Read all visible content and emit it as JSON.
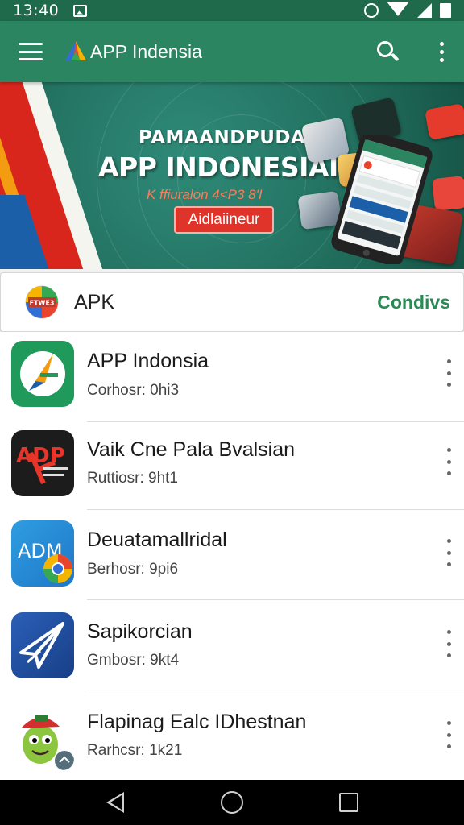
{
  "status_bar": {
    "time": "13:40"
  },
  "toolbar": {
    "title": "APP Indensia"
  },
  "banner": {
    "kicker": "PAMAANDPUDA",
    "headline": "APP INDONESIAI",
    "subline": "K ffiuralon 4<P3 8'I",
    "cta_label": "Aidlaiineur"
  },
  "apk_section": {
    "badge_text": "FTWE3",
    "label": "APK",
    "link_label": "Condivs"
  },
  "apps": [
    {
      "name": "APP Indonsia",
      "meta": "Corhosr: 0hi3",
      "icon": "compass-app-icon"
    },
    {
      "name": "Vaik Cne Pala Bvalsian",
      "meta": "Ruttiosr: 9ht1",
      "icon": "adp-app-icon",
      "icon_text": "ADP"
    },
    {
      "name": "Deuatamallridal",
      "meta": "Berhosr: 9pi6",
      "icon": "adm-app-icon",
      "icon_text": "ADM"
    },
    {
      "name": "Sapikorcian",
      "meta": "Gmbosr: 9kt4",
      "icon": "paper-plane-app-icon"
    },
    {
      "name": "Flapinag Ealc IDhestnan",
      "meta": "Rarhcsr: 1k21",
      "icon": "cartoon-character-app-icon"
    }
  ],
  "colors": {
    "toolbar": "#2a8560",
    "status_bar": "#1e6a4a",
    "accent_link": "#2a8a55",
    "cta": "#e0342a"
  }
}
